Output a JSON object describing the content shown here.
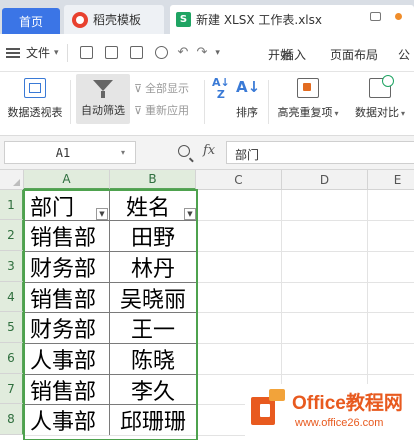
{
  "tabs": {
    "home": "首页",
    "template": "稻壳模板",
    "file": "新建 XLSX 工作表.xlsx",
    "file_icon_letter": "S"
  },
  "menu": {
    "file_label": "文件",
    "items": [
      "开始",
      "插入",
      "页面布局",
      "公"
    ]
  },
  "ribbon": {
    "pivot_label": "数据透视表",
    "autofilter_label": "自动筛选",
    "showall_label": "全部显示",
    "reapply_label": "重新应用",
    "sort_label": "排序",
    "highlight_dup_label": "高亮重复项",
    "compare_label": "数据对比"
  },
  "formula_bar": {
    "cell_ref": "A1",
    "fx": "fx",
    "content": "部门"
  },
  "columns": [
    "A",
    "B",
    "C",
    "D",
    "E"
  ],
  "rows": [
    {
      "num": "1",
      "a": "部门",
      "b": "姓名"
    },
    {
      "num": "2",
      "a": "销售部",
      "b": "田野"
    },
    {
      "num": "3",
      "a": "财务部",
      "b": "林丹"
    },
    {
      "num": "4",
      "a": "销售部",
      "b": "吴晓丽"
    },
    {
      "num": "5",
      "a": "财务部",
      "b": "王一"
    },
    {
      "num": "6",
      "a": "人事部",
      "b": "陈晓"
    },
    {
      "num": "7",
      "a": "销售部",
      "b": "李久"
    },
    {
      "num": "8",
      "a": "人事部",
      "b": "邱珊珊"
    }
  ],
  "watermark": {
    "title": "Office教程网",
    "url": "www.office26.com"
  },
  "colors": {
    "accent_blue": "#3b75e6",
    "sheet_green": "#1fa463",
    "selection_green": "#4ea24e",
    "watermark_orange": "#e85a1f"
  }
}
